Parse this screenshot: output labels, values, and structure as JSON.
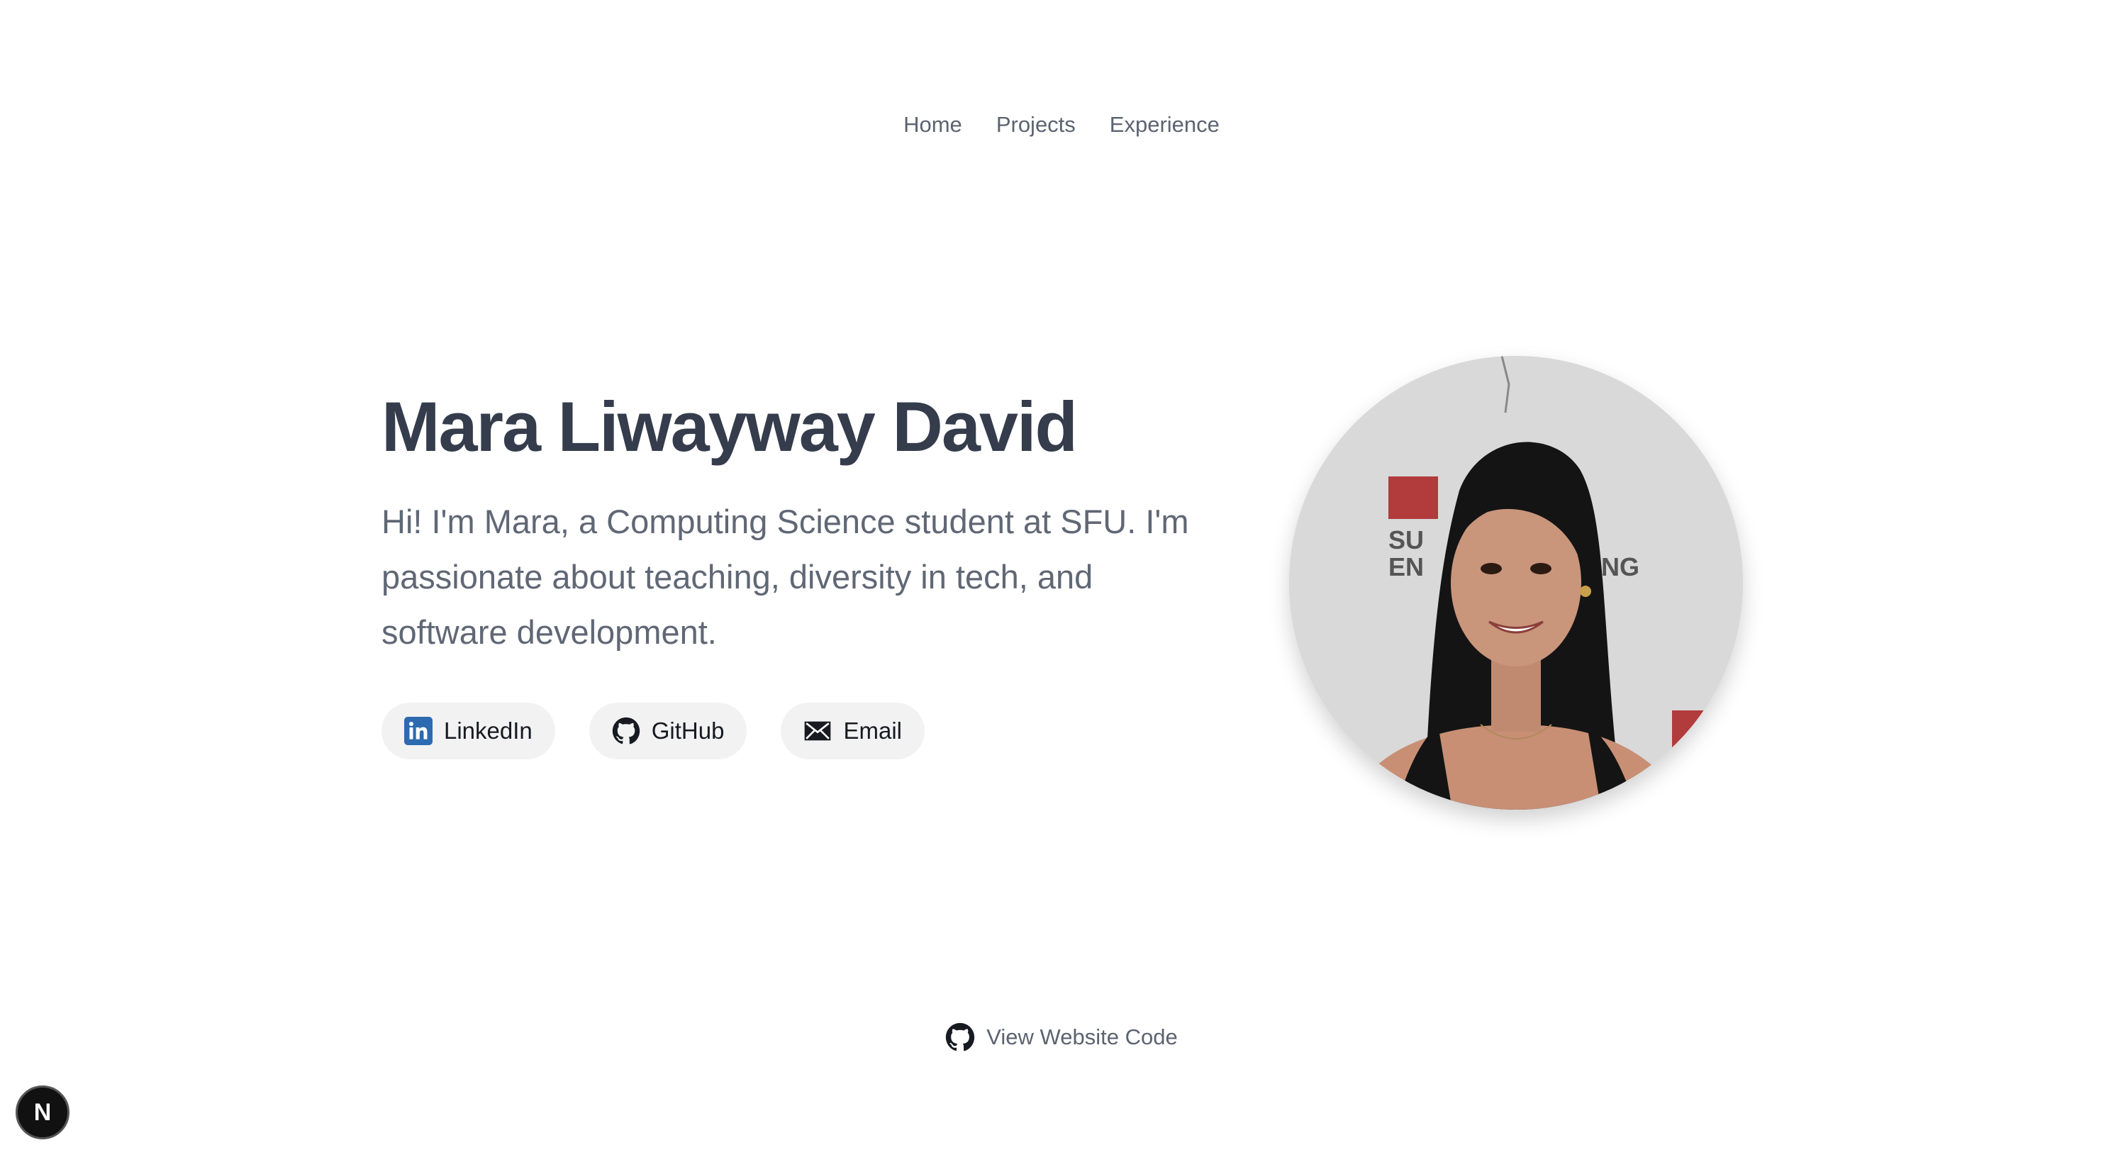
{
  "nav": {
    "items": [
      {
        "label": "Home"
      },
      {
        "label": "Projects"
      },
      {
        "label": "Experience"
      }
    ]
  },
  "hero": {
    "title": "Mara Liwayway David",
    "bio": "Hi! I'm Mara, a Computing Science student at SFU. I'm passionate about teaching, diversity in tech, and software development."
  },
  "links": [
    {
      "label": "LinkedIn",
      "icon": "linkedin-icon"
    },
    {
      "label": "GitHub",
      "icon": "github-icon"
    },
    {
      "label": "Email",
      "icon": "email-icon"
    }
  ],
  "footer": {
    "label": "View Website Code",
    "icon": "github-icon"
  },
  "badge": {
    "label": "N"
  },
  "colors": {
    "title": "#353c4c",
    "text": "#606775",
    "pill_bg": "#f2f2f3",
    "linkedin": "#2d6ab0"
  }
}
